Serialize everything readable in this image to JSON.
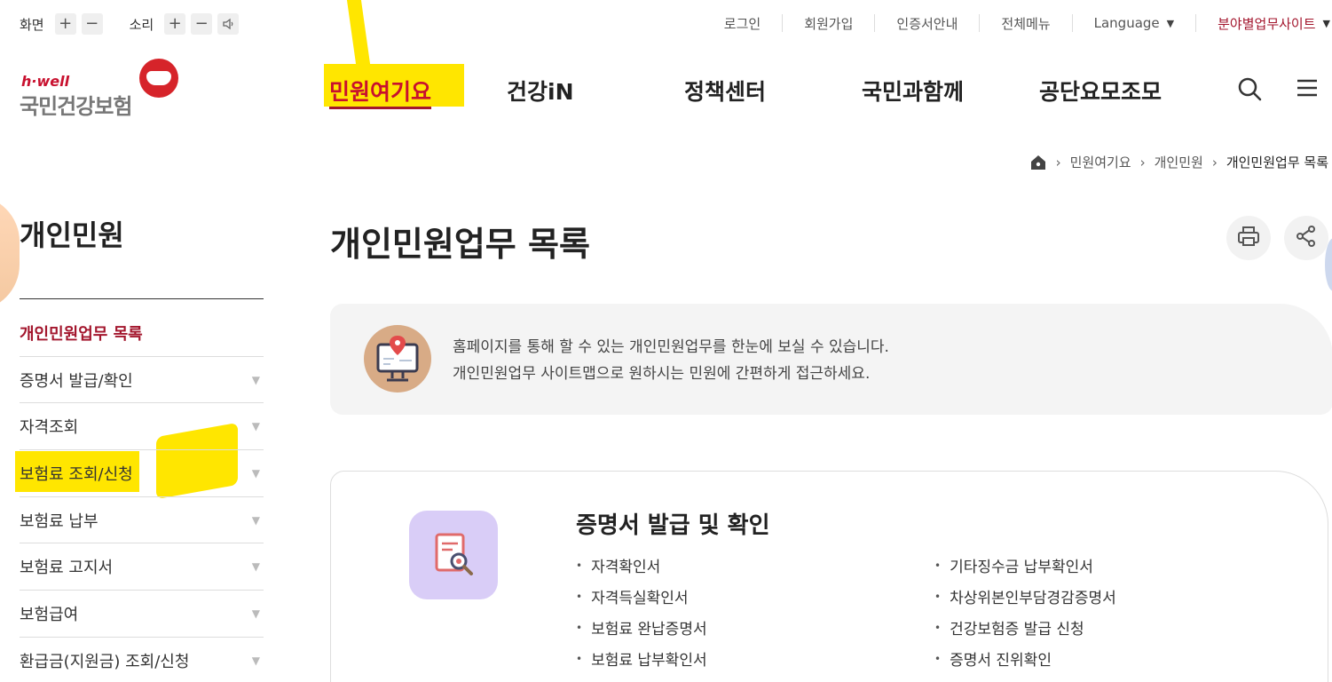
{
  "util": {
    "screen_label": "화면",
    "sound_label": "소리",
    "plus": "+",
    "minus": "−",
    "links": [
      "로그인",
      "회원가입",
      "인증서안내",
      "전체메뉴",
      "Language",
      "분야별업무사이트"
    ]
  },
  "logo": {
    "top": "h·well",
    "name": "국민건강보험"
  },
  "gnb": [
    "민원여기요",
    "건강iN",
    "정책센터",
    "국민과함께",
    "공단요모조모"
  ],
  "breadcrumb": [
    "민원여기요",
    "개인민원",
    "개인민원업무 목록"
  ],
  "sidebar": {
    "title": "개인민원",
    "items": [
      "개인민원업무 목록",
      "증명서 발급/확인",
      "자격조회",
      "보험료 조회/신청",
      "보험료 납부",
      "보험료 고지서",
      "보험급여",
      "환급금(지원금) 조회/신청"
    ]
  },
  "main": {
    "title": "개인민원업무 목록",
    "info_line1": "홈페이지를 통해 할 수 있는 개인민원업무를 한눈에 보실 수 있습니다.",
    "info_line2": "개인민원업무 사이트맵으로 원하시는 민원에 간편하게 접근하세요.",
    "card_title": "증명서 발급 및 확인",
    "col1": [
      "자격확인서",
      "자격득실확인서",
      "보험료 완납증명서",
      "보험료 납부확인서"
    ],
    "col2": [
      "기타징수금 납부확인서",
      "차상위본인부담경감증명서",
      "건강보험증 발급 신청",
      "증명서 진위확인"
    ]
  },
  "colors": {
    "accent": "#c8102e",
    "highlight": "#ffe600"
  }
}
